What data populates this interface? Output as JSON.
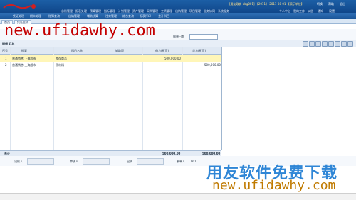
{
  "header": {
    "info_text": "[用友政务 abg001] 【2011】 2011-08-01 【演示单位】",
    "right_links": [
      "切换",
      "帮助",
      "退出"
    ],
    "menu": [
      "总账管理",
      "报表处理",
      "预算管理",
      "指标管理",
      "计划管理",
      "资产管理",
      "采购管理",
      "工资管理",
      "出纳管理",
      "项目管理",
      "业务协同",
      "系统服务"
    ],
    "menu_right": [
      "个人中心",
      "我的工作",
      "公告",
      "通知",
      "设置"
    ]
  },
  "submenu": {
    "items": [
      "凭证处理",
      "期末处理",
      "账簿查询",
      "出纳管理",
      "辅助核算",
      "往来管理",
      "综合查询",
      "报表打印",
      "会计科目"
    ],
    "tabs": [
      "首页",
      "凭证生成"
    ]
  },
  "watermark": {
    "url_top": "new.ufidawhy.com",
    "cn_text": "用友软件免费下载",
    "url_bottom": "new.ufidawhy.com"
  },
  "query": {
    "date_label": "制单日期"
  },
  "grid": {
    "title": "明细 汇总",
    "columns": [
      "序号",
      "摘要",
      "科目名称",
      "辅助项",
      "借方(原币)",
      "贷方(原币)"
    ],
    "rows": [
      {
        "no": "1",
        "summary": "普通销售:上海超市",
        "subject": "库存商品",
        "aux": "",
        "debit": "500,000.00",
        "credit": ""
      },
      {
        "no": "2",
        "summary": "普通销售:上海超市",
        "subject": "原材料",
        "aux": "",
        "debit": "",
        "credit": "500,000.00"
      }
    ],
    "total_label": "合计",
    "total_debit": "500,000.00",
    "total_credit": "500,000.00"
  },
  "sign": {
    "labels": [
      "记账人",
      "审核人",
      "出纳",
      "制单人"
    ],
    "maker_value": "001"
  }
}
